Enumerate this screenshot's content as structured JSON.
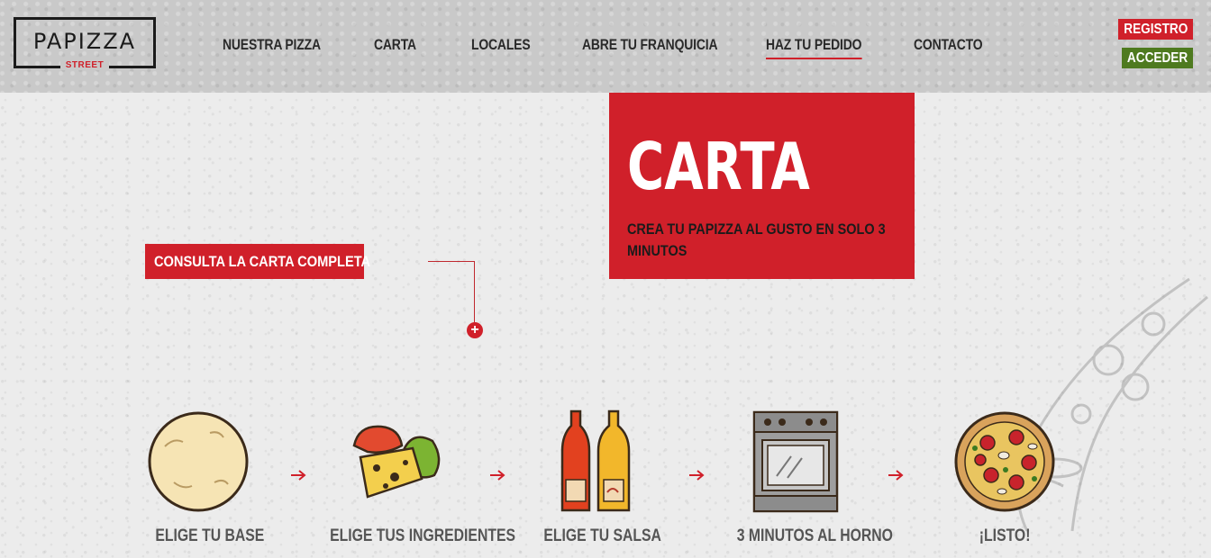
{
  "brand": {
    "name": "PAPIZZA",
    "sub": "STREET"
  },
  "nav": [
    {
      "label": "NUESTRA PIZZA"
    },
    {
      "label": "CARTA"
    },
    {
      "label": "LOCALES"
    },
    {
      "label": "ABRE TU FRANQUICIA"
    },
    {
      "label": "HAZ TU PEDIDO"
    },
    {
      "label": "CONTACTO"
    }
  ],
  "auth": {
    "registro": "REGISTRO",
    "acceder": "ACCEDER"
  },
  "hero": {
    "title": "CARTA",
    "subtitle": "CREA TU PAPIZZA AL GUSTO EN SOLO 3 MINUTOS"
  },
  "consulta": {
    "label": "CONSULTA LA CARTA COMPLETA"
  },
  "steps": [
    {
      "label": "ELIGE TU BASE",
      "icon": "pizza-dough-icon"
    },
    {
      "label": "ELIGE TUS INGREDIENTES",
      "icon": "ingredients-icon"
    },
    {
      "label": "ELIGE TU SALSA",
      "icon": "sauce-bottles-icon"
    },
    {
      "label": "3 MINUTOS AL HORNO",
      "icon": "oven-icon"
    },
    {
      "label": "¡LISTO!",
      "icon": "pizza-icon"
    }
  ],
  "colors": {
    "accent": "#d0202a",
    "green": "#4e7a1f",
    "header_bg": "#c9c9c9"
  }
}
